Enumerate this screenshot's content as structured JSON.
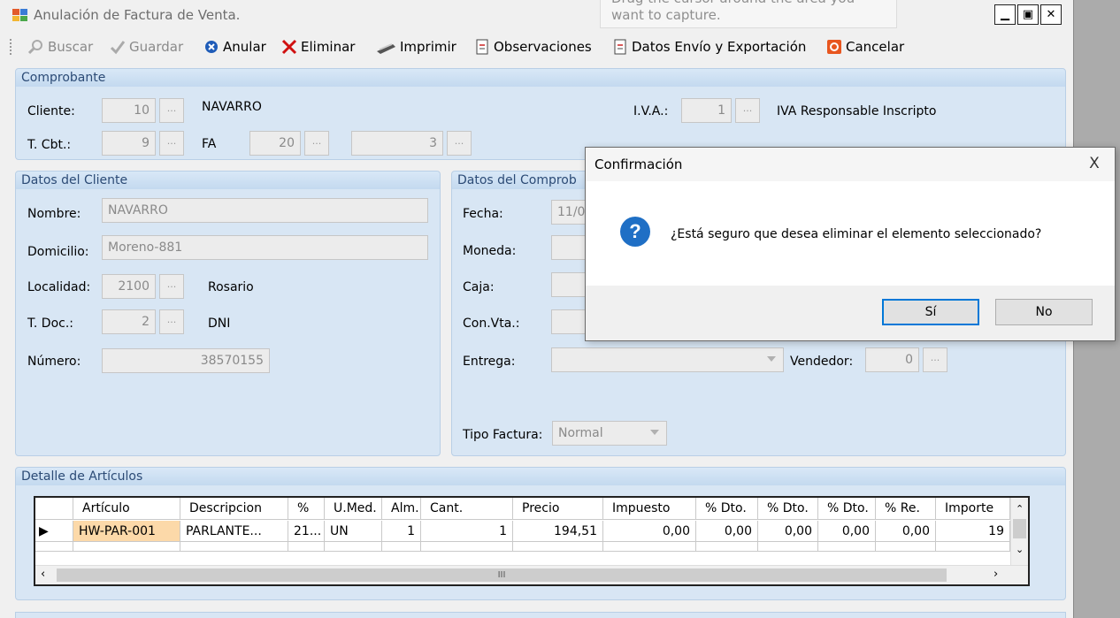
{
  "window": {
    "title": "Anulación de Factura de Venta.",
    "capture_hint": "Drag the cursor around the area you want to capture."
  },
  "toolbar": {
    "buscar": "Buscar",
    "guardar": "Guardar",
    "anular": "Anular",
    "eliminar": "Eliminar",
    "imprimir": "Imprimir",
    "observaciones": "Observaciones",
    "datos_envio": "Datos Envío y Exportación",
    "cancelar": "Cancelar"
  },
  "comprobante": {
    "header": "Comprobante",
    "cliente_label": "Cliente:",
    "cliente_code": "10",
    "cliente_name": "NAVARRO",
    "iva_label": "I.V.A.:",
    "iva_code": "1",
    "iva_name": "IVA Responsable Inscripto",
    "tcbt_label": "T. Cbt.:",
    "tcbt_code": "9",
    "tcbt_name": "FA",
    "pv": "20",
    "numero": "3"
  },
  "cliente": {
    "header": "Datos del Cliente",
    "nombre_label": "Nombre:",
    "nombre": "NAVARRO",
    "domicilio_label": "Domicilio:",
    "domicilio": "Moreno-881",
    "localidad_label": "Localidad:",
    "localidad_code": "2100",
    "localidad_name": "Rosario",
    "tdoc_label": "T. Doc.:",
    "tdoc_code": "2",
    "tdoc_name": "DNI",
    "numero_label": "Número:",
    "numero": "38570155"
  },
  "comprobante_datos": {
    "header": "Datos del Comprob",
    "fecha_label": "Fecha:",
    "fecha": "11/0",
    "moneda_label": "Moneda:",
    "caja_label": "Caja:",
    "convta_label": "Con.Vta.:",
    "entrega_label": "Entrega:",
    "vendedor_label": "Vendedor:",
    "vendedor": "0",
    "tipo_label": "Tipo Factura:",
    "tipo": "Normal"
  },
  "detalle": {
    "header": "Detalle de Artículos",
    "columns": [
      "Artículo",
      "Descripcion",
      "%",
      "U.Med.",
      "Alm.",
      "Cant.",
      "Precio",
      "Impuesto",
      "% Dto.",
      "% Dto.",
      "% Dto.",
      "% Re.",
      "Importe"
    ],
    "row": [
      "HW-PAR-001",
      "PARLANTE...",
      "21...",
      "UN",
      "1",
      "1",
      "194,51",
      "0,00",
      "0,00",
      "0,00",
      "0,00",
      "0,00",
      "19"
    ],
    "scroll_mark": "III"
  },
  "dialog": {
    "title": "Confirmación",
    "close": "X",
    "icon": "?",
    "message": "¿Está seguro que desea eliminar el elemento seleccionado?",
    "yes": "Sí",
    "no": "No"
  }
}
